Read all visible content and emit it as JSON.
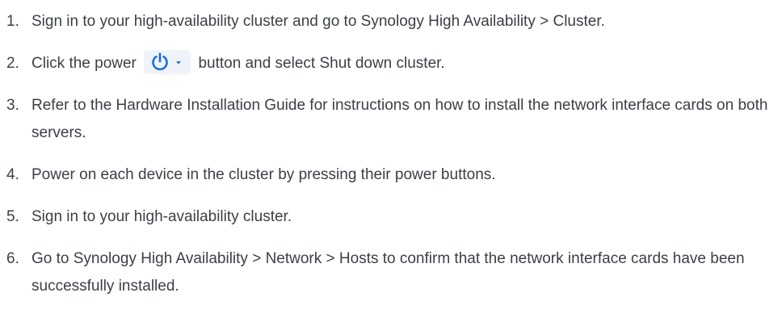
{
  "steps": [
    {
      "num": "1.",
      "text": "Sign in to your high-availability cluster and go to Synology High Availability > Cluster."
    },
    {
      "num": "2.",
      "text_before": "Click the power",
      "text_after": "button and select Shut down cluster."
    },
    {
      "num": "3.",
      "text": "Refer to the Hardware Installation Guide for instructions on how to install the network interface cards on both servers."
    },
    {
      "num": "4.",
      "text": "Power on each device in the cluster by pressing their power buttons."
    },
    {
      "num": "5.",
      "text": "Sign in to your high-availability cluster."
    },
    {
      "num": "6.",
      "text": "Go to Synology High Availability > Network > Hosts to confirm that the network interface cards have been successfully installed."
    }
  ],
  "power_button": {
    "icon": "power-icon",
    "dropdown_icon": "caret-down-icon",
    "color": "#1c6cd9"
  }
}
